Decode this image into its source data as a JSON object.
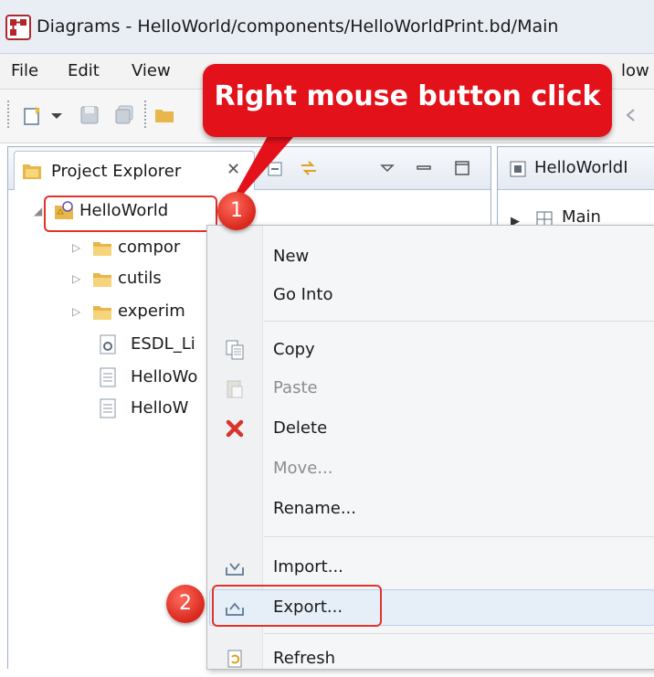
{
  "window": {
    "title": "Diagrams - HelloWorld/components/HelloWorldPrint.bd/Main"
  },
  "menubar": {
    "items": [
      "File",
      "Edit",
      "View",
      "low"
    ]
  },
  "explorer": {
    "tab_label": "Project Explorer",
    "close_glyph": "✕",
    "tree": [
      {
        "label": "HelloWorld",
        "icon": "project-icon",
        "twisty": "expanded"
      },
      {
        "label": "compor",
        "icon": "folder-icon",
        "twisty": "collapsed"
      },
      {
        "label": "cutils",
        "icon": "folder-icon",
        "twisty": "collapsed"
      },
      {
        "label": "experim",
        "icon": "folder-icon",
        "twisty": "collapsed"
      },
      {
        "label": "ESDL_Li",
        "icon": "gear-file-icon",
        "twisty": "none"
      },
      {
        "label": "HelloWo",
        "icon": "text-file-icon",
        "twisty": "none"
      },
      {
        "label": "HelloW",
        "icon": "text-file-icon",
        "twisty": "none"
      }
    ]
  },
  "editor": {
    "tab_label": "HelloWorldI",
    "tree_item": "Main"
  },
  "context_menu": {
    "items": [
      {
        "label": "New",
        "enabled": true
      },
      {
        "label": "Go Into",
        "enabled": true
      },
      {
        "label": "Copy",
        "enabled": true,
        "icon": "copy-icon"
      },
      {
        "label": "Paste",
        "enabled": false,
        "icon": "paste-icon"
      },
      {
        "label": "Delete",
        "enabled": true,
        "icon": "delete-icon"
      },
      {
        "label": "Move...",
        "enabled": false
      },
      {
        "label": "Rename...",
        "enabled": true
      },
      {
        "label": "Import...",
        "enabled": true,
        "icon": "import-icon"
      },
      {
        "label": "Export...",
        "enabled": true,
        "icon": "export-icon",
        "highlighted": true
      },
      {
        "label": "Refresh",
        "enabled": true,
        "icon": "refresh-icon"
      }
    ]
  },
  "annotations": {
    "callout_text": "Right mouse button click",
    "step1": "1",
    "step2": "2"
  },
  "colors": {
    "accent_red": "#e3111a",
    "frame_red": "#e0342a",
    "selection": "#e6eef8"
  }
}
